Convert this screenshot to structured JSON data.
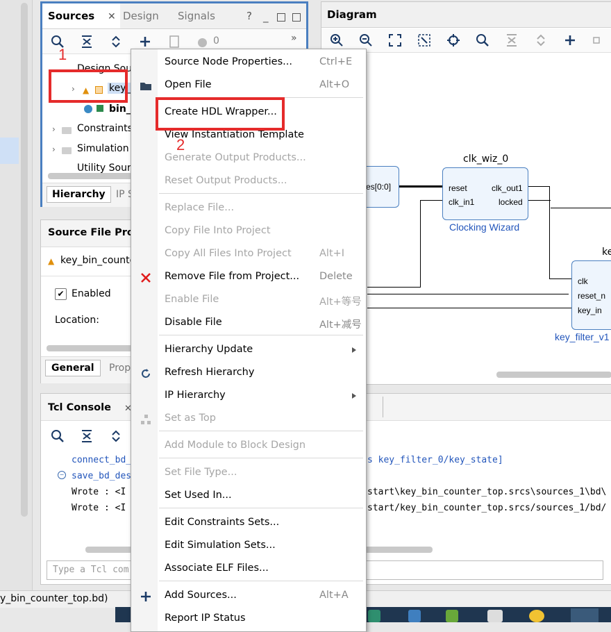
{
  "sources_panel": {
    "tabs": [
      "Sources",
      "Design",
      "Signals"
    ],
    "toolbar_badge": "0",
    "tree": {
      "design_sources": "Design Sou",
      "key_item": "key_",
      "bin_item": "bin_c",
      "constraints": "Constraints",
      "simulation": "Simulation S",
      "utility": "Utility Sourc"
    },
    "bottom_tabs": [
      "Hierarchy",
      "IP S"
    ]
  },
  "props_panel": {
    "title": "Source File Prop",
    "file": "key_bin_counte",
    "enabled_label": "Enabled",
    "location_label": "Location:",
    "bottom_tabs": [
      "General",
      "Prop"
    ]
  },
  "tcl_panel": {
    "title": "Tcl Console",
    "lines": [
      {
        "left": "connect_bd_",
        "right": "s key_filter_0/key_state]"
      },
      {
        "left": "save_bd_des",
        "right": ""
      },
      {
        "left": "Wrote  : <I",
        "right": "start\\key_bin_counter_top.srcs\\sources_1\\bd\\"
      },
      {
        "left": "Wrote  : <I",
        "right": "start/key_bin_counter_top.srcs/sources_1/bd/"
      }
    ],
    "input_placeholder": "Type a Tcl com"
  },
  "status_bar": {
    "text": "y_bin_counter_top.bd)"
  },
  "diagram": {
    "title": "Diagram",
    "clk_wiz": {
      "name": "clk_wiz_0",
      "pins_left": [
        "reset",
        "clk_in1"
      ],
      "pins_right": [
        "clk_out1",
        "locked"
      ],
      "caption": "Clocking Wizard"
    },
    "left_block_pin": "es[0:0]",
    "key_filter": {
      "name": "ke",
      "pins": [
        "clk",
        "reset_n",
        "key_in"
      ],
      "caption": "key_filter_v1"
    }
  },
  "context_menu": {
    "items": [
      {
        "label": "Source Node Properties...",
        "shortcut": "Ctrl+E",
        "disabled": false,
        "icon": ""
      },
      {
        "label": "Open File",
        "shortcut": "Alt+O",
        "disabled": false,
        "icon": "folder-icon"
      },
      {
        "label": "Create HDL Wrapper...",
        "shortcut": "",
        "disabled": false,
        "icon": ""
      },
      {
        "label": "View Instantiation Template",
        "shortcut": "",
        "disabled": false,
        "icon": ""
      },
      {
        "label": "Generate Output Products...",
        "shortcut": "",
        "disabled": true,
        "icon": ""
      },
      {
        "label": "Reset Output Products...",
        "shortcut": "",
        "disabled": true,
        "icon": ""
      },
      {
        "label": "Replace File...",
        "shortcut": "",
        "disabled": true,
        "icon": ""
      },
      {
        "label": "Copy File Into Project",
        "shortcut": "",
        "disabled": true,
        "icon": ""
      },
      {
        "label": "Copy All Files Into Project",
        "shortcut": "Alt+I",
        "disabled": true,
        "icon": ""
      },
      {
        "label": "Remove File from Project...",
        "shortcut": "Delete",
        "disabled": false,
        "icon": "remove-icon"
      },
      {
        "label": "Enable File",
        "shortcut": "Alt+等号",
        "disabled": true,
        "icon": ""
      },
      {
        "label": "Disable File",
        "shortcut": "Alt+减号",
        "disabled": false,
        "icon": ""
      },
      {
        "label": "Hierarchy Update",
        "shortcut": "",
        "disabled": false,
        "icon": "",
        "submenu": true
      },
      {
        "label": "Refresh Hierarchy",
        "shortcut": "",
        "disabled": false,
        "icon": "refresh-icon"
      },
      {
        "label": "IP Hierarchy",
        "shortcut": "",
        "disabled": false,
        "icon": "",
        "submenu": true
      },
      {
        "label": "Set as Top",
        "shortcut": "",
        "disabled": true,
        "icon": "hierarchy-icon"
      },
      {
        "label": "Add Module to Block Design",
        "shortcut": "",
        "disabled": true,
        "icon": ""
      },
      {
        "label": "Set File Type...",
        "shortcut": "",
        "disabled": true,
        "icon": ""
      },
      {
        "label": "Set Used In...",
        "shortcut": "",
        "disabled": false,
        "icon": ""
      },
      {
        "label": "Edit Constraints Sets...",
        "shortcut": "",
        "disabled": false,
        "icon": ""
      },
      {
        "label": "Edit Simulation Sets...",
        "shortcut": "",
        "disabled": false,
        "icon": ""
      },
      {
        "label": "Associate ELF Files...",
        "shortcut": "",
        "disabled": false,
        "icon": ""
      },
      {
        "label": "Add Sources...",
        "shortcut": "Alt+A",
        "disabled": false,
        "icon": "plus-icon"
      },
      {
        "label": "Report IP Status",
        "shortcut": "",
        "disabled": false,
        "icon": ""
      }
    ]
  },
  "annotations": {
    "one": "1",
    "two": "2"
  },
  "colors": {
    "highlight_red": "#e52b2b",
    "selection_blue": "#4a7fc0",
    "panel_focus": "#4a7fc0"
  }
}
